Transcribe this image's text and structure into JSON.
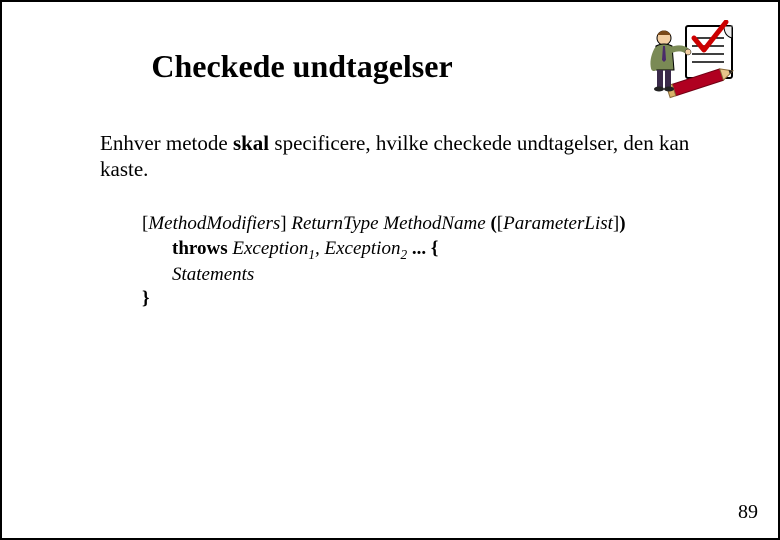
{
  "title": "Checkede undtagelser",
  "paragraph": {
    "pre": "Enhver metode ",
    "bold": "skal",
    "post": " specificere, hvilke checkede undtagelser, den kan kaste."
  },
  "syntax": {
    "lbr": "[",
    "mm": "MethodModifiers",
    "rbr": "] ",
    "rt": "ReturnType",
    "sp": " ",
    "mn": "MethodName",
    "op": " (",
    "lbr2": "[",
    "pl": "ParameterList",
    "rbr2": "]",
    "cp": ")",
    "throws": "throws ",
    "ex": "Exception",
    "one": "1",
    "comma": ", ",
    "two": "2",
    "dots": " ... ",
    "ob": "{",
    "stm": "Statements",
    "cb": "}"
  },
  "pagenum": "89"
}
